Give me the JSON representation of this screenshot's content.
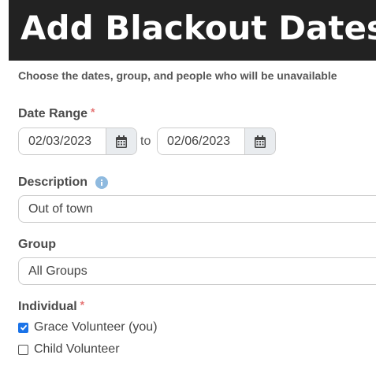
{
  "header": {
    "title": "Add Blackout Dates"
  },
  "subtitle": "Choose the dates, group, and people who will be unavailable",
  "date_range": {
    "label": "Date Range",
    "required_mark": "*",
    "start_value": "02/03/2023",
    "separator": "to",
    "end_value": "02/06/2023",
    "calendar_icon": "calendar-icon"
  },
  "description": {
    "label": "Description",
    "info_icon": "info-icon",
    "value": "Out of town"
  },
  "group": {
    "label": "Group",
    "value": "All Groups"
  },
  "individual": {
    "label": "Individual",
    "required_mark": "*",
    "options": [
      {
        "label": "Grace Volunteer (you)",
        "checked": true
      },
      {
        "label": "Child Volunteer",
        "checked": false
      }
    ]
  },
  "colors": {
    "header_bg": "#222222",
    "required": "#e57373",
    "checkbox_accent": "#1a73e8",
    "info_icon": "#8fbadf"
  }
}
